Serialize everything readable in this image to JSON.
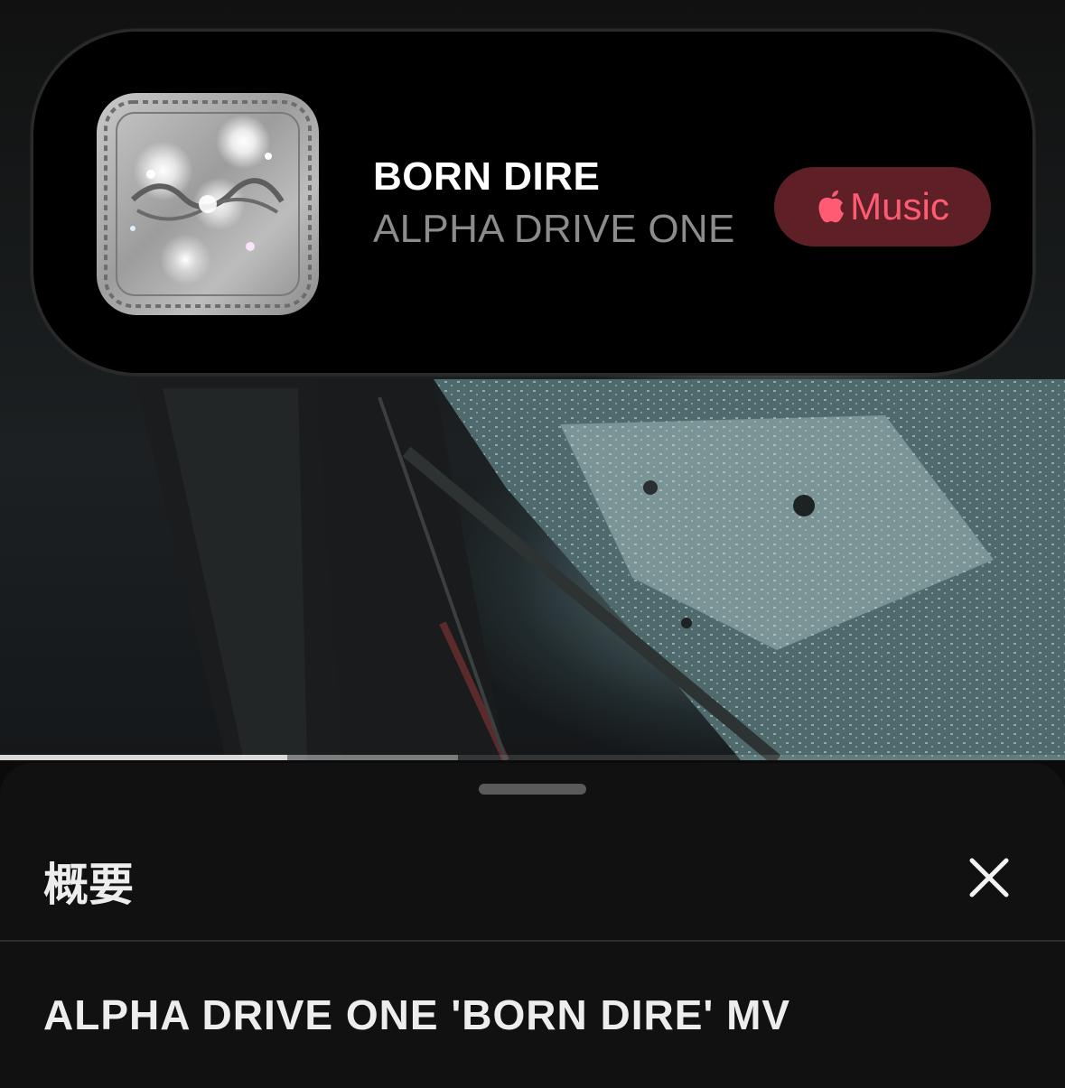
{
  "now_playing": {
    "title": "BORN DIRE",
    "artist": "ALPHA DRIVE ONE",
    "music_button_label": "Music",
    "music_button_icon": "apple-logo-icon"
  },
  "player": {
    "progress": 0.27,
    "buffered": 0.43
  },
  "description_sheet": {
    "heading": "概要",
    "close_icon": "close-icon",
    "video_title": "ALPHA DRIVE ONE 'BORN DIRE' MV"
  },
  "colors": {
    "music_button_bg": "#5e1f27",
    "music_accent": "#ff5c73",
    "sheet_bg": "#111111"
  }
}
